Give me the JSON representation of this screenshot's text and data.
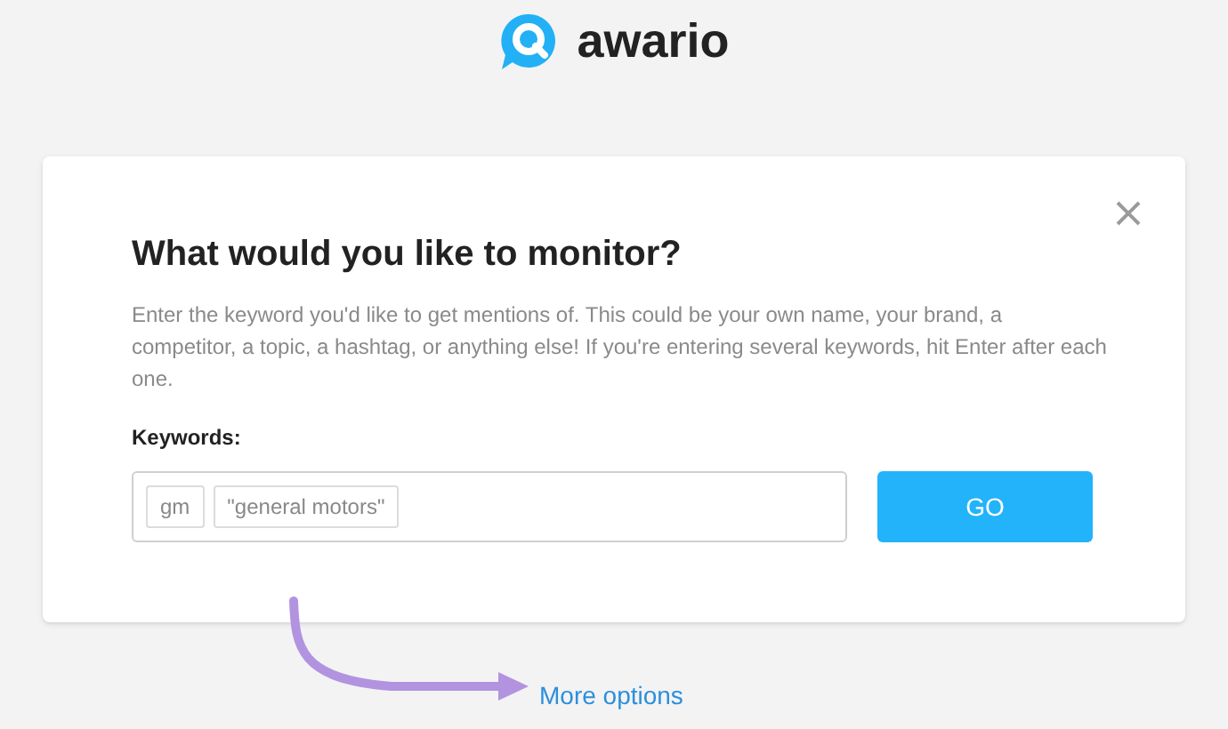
{
  "logo": {
    "name": "awario"
  },
  "dialog": {
    "title": "What would you like to monitor?",
    "description": "Enter the keyword you'd like to get mentions of. This could be your own name, your brand, a competitor, a topic, a hashtag, or anything else! If you're entering several keywords, hit Enter after each one.",
    "keywords_label": "Keywords:",
    "keywords": [
      "gm",
      "\"general motors\""
    ],
    "go_button": "GO"
  },
  "more_options_link": "More options"
}
